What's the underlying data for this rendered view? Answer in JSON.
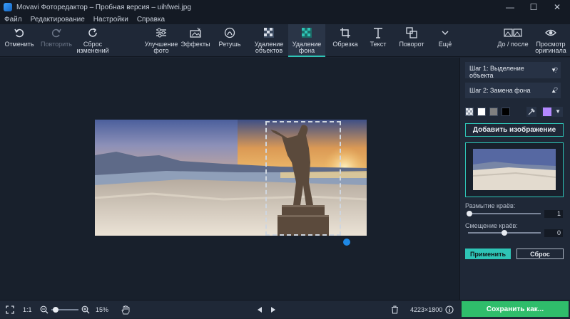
{
  "window": {
    "title": "Movavi Фоторедактор – Пробная версия – uihfwei.jpg"
  },
  "menu": [
    "Файл",
    "Редактирование",
    "Настройки",
    "Справка"
  ],
  "toolbar": {
    "undo": "Отменить",
    "redo": "Повторить",
    "reset": "Сброс изменений",
    "enhance": "Улучшение фото",
    "effects": "Эффекты",
    "retouch": "Ретушь",
    "object_removal": "Удаление объектов",
    "background_removal": "Удаление фона",
    "crop": "Обрезка",
    "text": "Текст",
    "rotate": "Поворот",
    "more": "Ещё",
    "before_after": "До / после",
    "view_original": "Просмотр оригинала"
  },
  "panel": {
    "step1": "Шаг 1: Выделение объекта",
    "step2": "Шаг 2: Замена фона",
    "help": "?",
    "add_image": "Добавить изображение",
    "edge_blur_label": "Размытие краёв:",
    "edge_blur_value": "1",
    "edge_shift_label": "Смещение краёв:",
    "edge_shift_value": "0",
    "apply": "Применить",
    "reset": "Сброс",
    "swatch_colors": [
      "#ffffff",
      "#808080",
      "#000000"
    ],
    "picked_color": "#b388ff"
  },
  "slider_levels": {
    "edge_blur": 0.02,
    "edge_shift": 0.5,
    "zoom": 0.15
  },
  "status": {
    "fit": "1:1",
    "zoom": "15%",
    "dimensions": "4223×1800",
    "save": "Сохранить как..."
  },
  "colors": {
    "accent": "#2ec4b6",
    "save": "#2fbd6b",
    "bg": "#1c2431"
  }
}
